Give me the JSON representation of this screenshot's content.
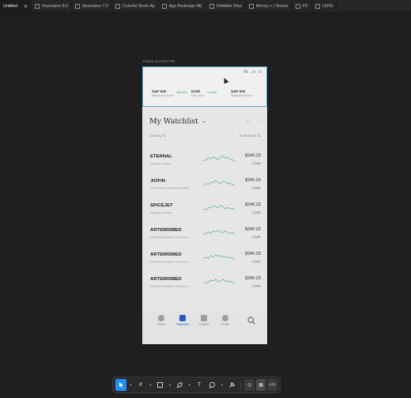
{
  "tabs": [
    {
      "label": "Untitled",
      "icon": "file-icon",
      "active": true
    },
    {
      "label": "Illustration 8.0",
      "icon": "figma-icon"
    },
    {
      "label": "Illustration 7.0",
      "icon": "figma-icon"
    },
    {
      "label": "Colorful Stock Ap",
      "icon": "figma-icon"
    },
    {
      "label": "App Redesign NE",
      "icon": "figma-icon"
    },
    {
      "label": "Dribbble Shot",
      "icon": "figma-icon"
    },
    {
      "label": "Money + | Stocks",
      "icon": "figma-icon"
    },
    {
      "label": "FD",
      "icon": "figma-icon"
    },
    {
      "label": "LENS",
      "icon": "figma-icon"
    }
  ],
  "frame_label": "Frame 2147227725",
  "phone": {
    "tickers": [
      {
        "name": "S&P 500",
        "sub": "Standard & Poor's",
        "change": "+46.00%"
      },
      {
        "name": "DOW",
        "sub": "Dow Jones",
        "change": "+1.40%"
      },
      {
        "name": "S&P 500",
        "sub": "Standard & Poor's",
        "change": ""
      }
    ],
    "watchlist_title": "My Watchlist",
    "add_icon": "+",
    "more_icon": "···",
    "sort_by": "Sort By",
    "returns": "Returns",
    "stocks": [
      {
        "symbol": "ETERNAL",
        "company": "Eternal Limited",
        "price": "$340.23",
        "change": "3.4%"
      },
      {
        "symbol": "JIOFIN",
        "company": "Jio Finance Services Limited",
        "price": "$340.23",
        "change": "3.4%"
      },
      {
        "symbol": "SPICEJET",
        "company": "Spicejet Limited",
        "price": "$340.23",
        "change": "3.4%"
      },
      {
        "symbol": "ARTEMISMED",
        "company": "Artemis Medicare Services L...",
        "price": "$340.23",
        "change": "3.4%"
      },
      {
        "symbol": "ARTEMISMED",
        "company": "Artemis Medicare Services L...",
        "price": "$340.23",
        "change": "3.4%"
      },
      {
        "symbol": "ARTEMISMED",
        "company": "Artemis Medicare Services L...",
        "price": "$340.23",
        "change": "3.4%"
      }
    ],
    "nav": [
      {
        "label": "Home",
        "icon": "home-icon"
      },
      {
        "label": "Watchlist",
        "icon": "watchlist-icon",
        "active": true
      },
      {
        "label": "Portfolio",
        "icon": "portfolio-icon"
      },
      {
        "label": "Profile",
        "icon": "profile-icon"
      }
    ]
  },
  "toolbar": {
    "tools": [
      "move-tool-icon",
      "frame-tool-icon",
      "shape-tool-icon",
      "pen-tool-icon",
      "text-tool-icon",
      "comment-tool-icon",
      "actions-tool-icon"
    ],
    "modes": [
      "design-mode-icon",
      "prototype-mode-icon",
      "dev-mode-icon"
    ]
  },
  "colors": {
    "accent": "#1e90ff",
    "positive": "#2ea44f",
    "active_nav": "#2557c9",
    "selection": "#5aa9c8"
  }
}
